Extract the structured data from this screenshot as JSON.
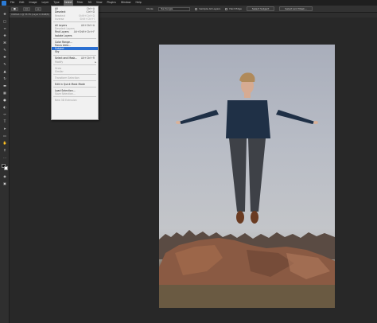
{
  "menubar": {
    "items": [
      "File",
      "Edit",
      "Image",
      "Layer",
      "Type",
      "Select",
      "Filter",
      "3D",
      "View",
      "Plugins",
      "Window",
      "Help"
    ],
    "active_index": 5
  },
  "optionsbar": {
    "mode_label": "Mode:",
    "mode_value": "Rectangle",
    "sample_all_layers": "Sample All Layers",
    "hard_edge": "Hard Edge",
    "select_subject": "Select Subject",
    "select_and_mask": "Select and Mask..."
  },
  "document": {
    "tab_title": "Untitled-1 @ 33.3% (Layer 0, RGB/8)"
  },
  "select_menu": {
    "groups": [
      [
        {
          "label": "All",
          "shortcut": "Ctrl+A",
          "enabled": true
        },
        {
          "label": "Deselect",
          "shortcut": "Ctrl+D",
          "enabled": true
        },
        {
          "label": "Reselect",
          "shortcut": "Shift+Ctrl+D",
          "enabled": false
        },
        {
          "label": "Inverse",
          "shortcut": "Shift+Ctrl+I",
          "enabled": false
        }
      ],
      [
        {
          "label": "All Layers",
          "shortcut": "Alt+Ctrl+A",
          "enabled": true
        },
        {
          "label": "Deselect Layers",
          "shortcut": "",
          "enabled": false
        },
        {
          "label": "Find Layers",
          "shortcut": "Alt+Shift+Ctrl+F",
          "enabled": true
        },
        {
          "label": "Isolate Layers",
          "shortcut": "",
          "enabled": true
        }
      ],
      [
        {
          "label": "Color Range...",
          "shortcut": "",
          "enabled": true
        },
        {
          "label": "Focus Area...",
          "shortcut": "",
          "enabled": true
        },
        {
          "label": "Subject",
          "shortcut": "",
          "enabled": true,
          "highlight": true
        },
        {
          "label": "Sky",
          "shortcut": "",
          "enabled": true
        }
      ],
      [
        {
          "label": "Select and Mask...",
          "shortcut": "Alt+Ctrl+R",
          "enabled": true
        },
        {
          "label": "Modify",
          "shortcut": "",
          "enabled": false,
          "submenu": true
        }
      ],
      [
        {
          "label": "Grow",
          "shortcut": "",
          "enabled": false
        },
        {
          "label": "Similar",
          "shortcut": "",
          "enabled": false
        }
      ],
      [
        {
          "label": "Transform Selection",
          "shortcut": "",
          "enabled": false
        }
      ],
      [
        {
          "label": "Edit in Quick Mask Mode",
          "shortcut": "",
          "enabled": true
        }
      ],
      [
        {
          "label": "Load Selection...",
          "shortcut": "",
          "enabled": true
        },
        {
          "label": "Save Selection...",
          "shortcut": "",
          "enabled": false
        }
      ],
      [
        {
          "label": "New 3D Extrusion",
          "shortcut": "",
          "enabled": false
        }
      ]
    ]
  },
  "colors": {
    "menu_highlight": "#2a6fd1",
    "app_bg": "#262626",
    "logo_blue": "#2b7bd6"
  },
  "icons": [
    "move-icon",
    "marquee-icon",
    "lasso-icon",
    "quick-select-icon",
    "crop-icon",
    "eyedropper-icon",
    "healing-icon",
    "brush-icon",
    "stamp-icon",
    "history-brush-icon",
    "eraser-icon",
    "gradient-icon",
    "blur-icon",
    "dodge-icon",
    "pen-icon",
    "type-icon",
    "path-select-icon",
    "rectangle-icon",
    "hand-icon",
    "zoom-icon"
  ]
}
